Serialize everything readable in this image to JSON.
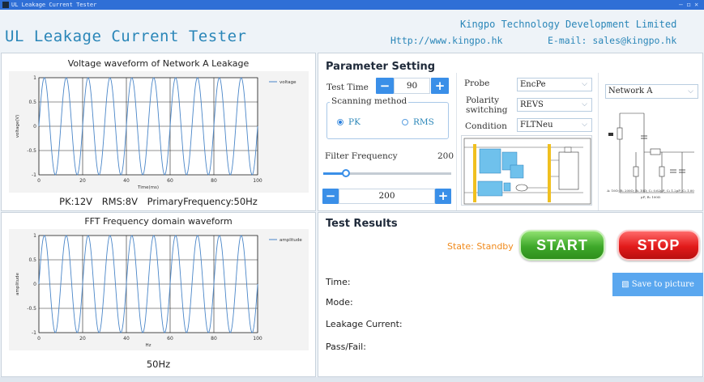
{
  "window": {
    "title": "UL Leakage Current Tester",
    "controls": "–  ◻  ✕"
  },
  "header": {
    "app_title": "UL Leakage Current Tester",
    "company": "Kingpo Technology Development Limited",
    "website": "Http://www.kingpo.hk",
    "email": "E-mail: sales@kingpo.hk"
  },
  "voltage_chart": {
    "title": "Voltage waveform of Network A Leakage",
    "stats": {
      "pk": "PK:12V",
      "rms": "RMS:8V",
      "freq": "PrimaryFrequency:50Hz"
    }
  },
  "fft_chart": {
    "title": "FFT Frequency domain waveform",
    "stats": "50Hz"
  },
  "chart_data": [
    {
      "type": "line",
      "series": [
        {
          "name": "voltage",
          "function": "sin",
          "cycles": 10,
          "amplitude": 1
        }
      ],
      "x_range": [
        0,
        100
      ],
      "ylim": [
        -1,
        1
      ],
      "xticks": [
        "0",
        "20",
        "40",
        "60",
        "80",
        "100"
      ],
      "yticks": [
        "1",
        "0.5",
        "0",
        "-0.5",
        "-1"
      ],
      "xlabel": "Time(ms)",
      "ylabel": "voltage(V)",
      "legend": "top-right",
      "grid": true
    },
    {
      "type": "line",
      "series": [
        {
          "name": "amplitude",
          "function": "sin",
          "cycles": 10,
          "amplitude": 1
        }
      ],
      "x_range": [
        0,
        100
      ],
      "ylim": [
        -1,
        1
      ],
      "xticks": [
        "0",
        "20",
        "40",
        "60",
        "80",
        "100"
      ],
      "yticks": [
        "1",
        "0.5",
        "0",
        "-0.5",
        "-1"
      ],
      "xlabel": "Hz",
      "ylabel": "amplitude",
      "legend": "top-right",
      "grid": true
    }
  ],
  "params": {
    "title": "Parameter Setting",
    "test_time_label": "Test Time",
    "test_time_value": "90",
    "minus": "−",
    "plus": "+",
    "scanning_method_label": "Scanning method",
    "pk_label": "PK",
    "rms_label": "RMS",
    "filter_label": "Filter Frequency",
    "filter_value": "200",
    "filter_box_value": "200",
    "filter_slider_fraction": 0.18,
    "probe_label": "Probe",
    "probe_value": "EncPe",
    "polarity_label1": "Polarity",
    "polarity_label2": "switching",
    "polarity_value": "REVS",
    "condition_label": "Condition",
    "condition_value": "FLTNeu",
    "network_value": "Network A",
    "network_caption1": "A: 10Ω; R₁ 200Ω; R₂ 10Ω; C₁ 0.62μF; C₂ 1.2μF; C₃ 1.00",
    "network_caption2": "μF; R₃ 100Ω"
  },
  "results": {
    "title": "Test Results",
    "state": "State: Standby",
    "start_label": "START",
    "stop_label": "STOP",
    "save_label": "Save to picture",
    "time_label": "Time:",
    "mode_label": "Mode:",
    "leakage_label": "Leakage Current:",
    "passfail_label": "Pass/Fail:"
  },
  "colors": {
    "accent": "#3a8fe8",
    "title_text": "#2a86b8",
    "state": "#f08a1c",
    "wave": "#4a86c8"
  }
}
